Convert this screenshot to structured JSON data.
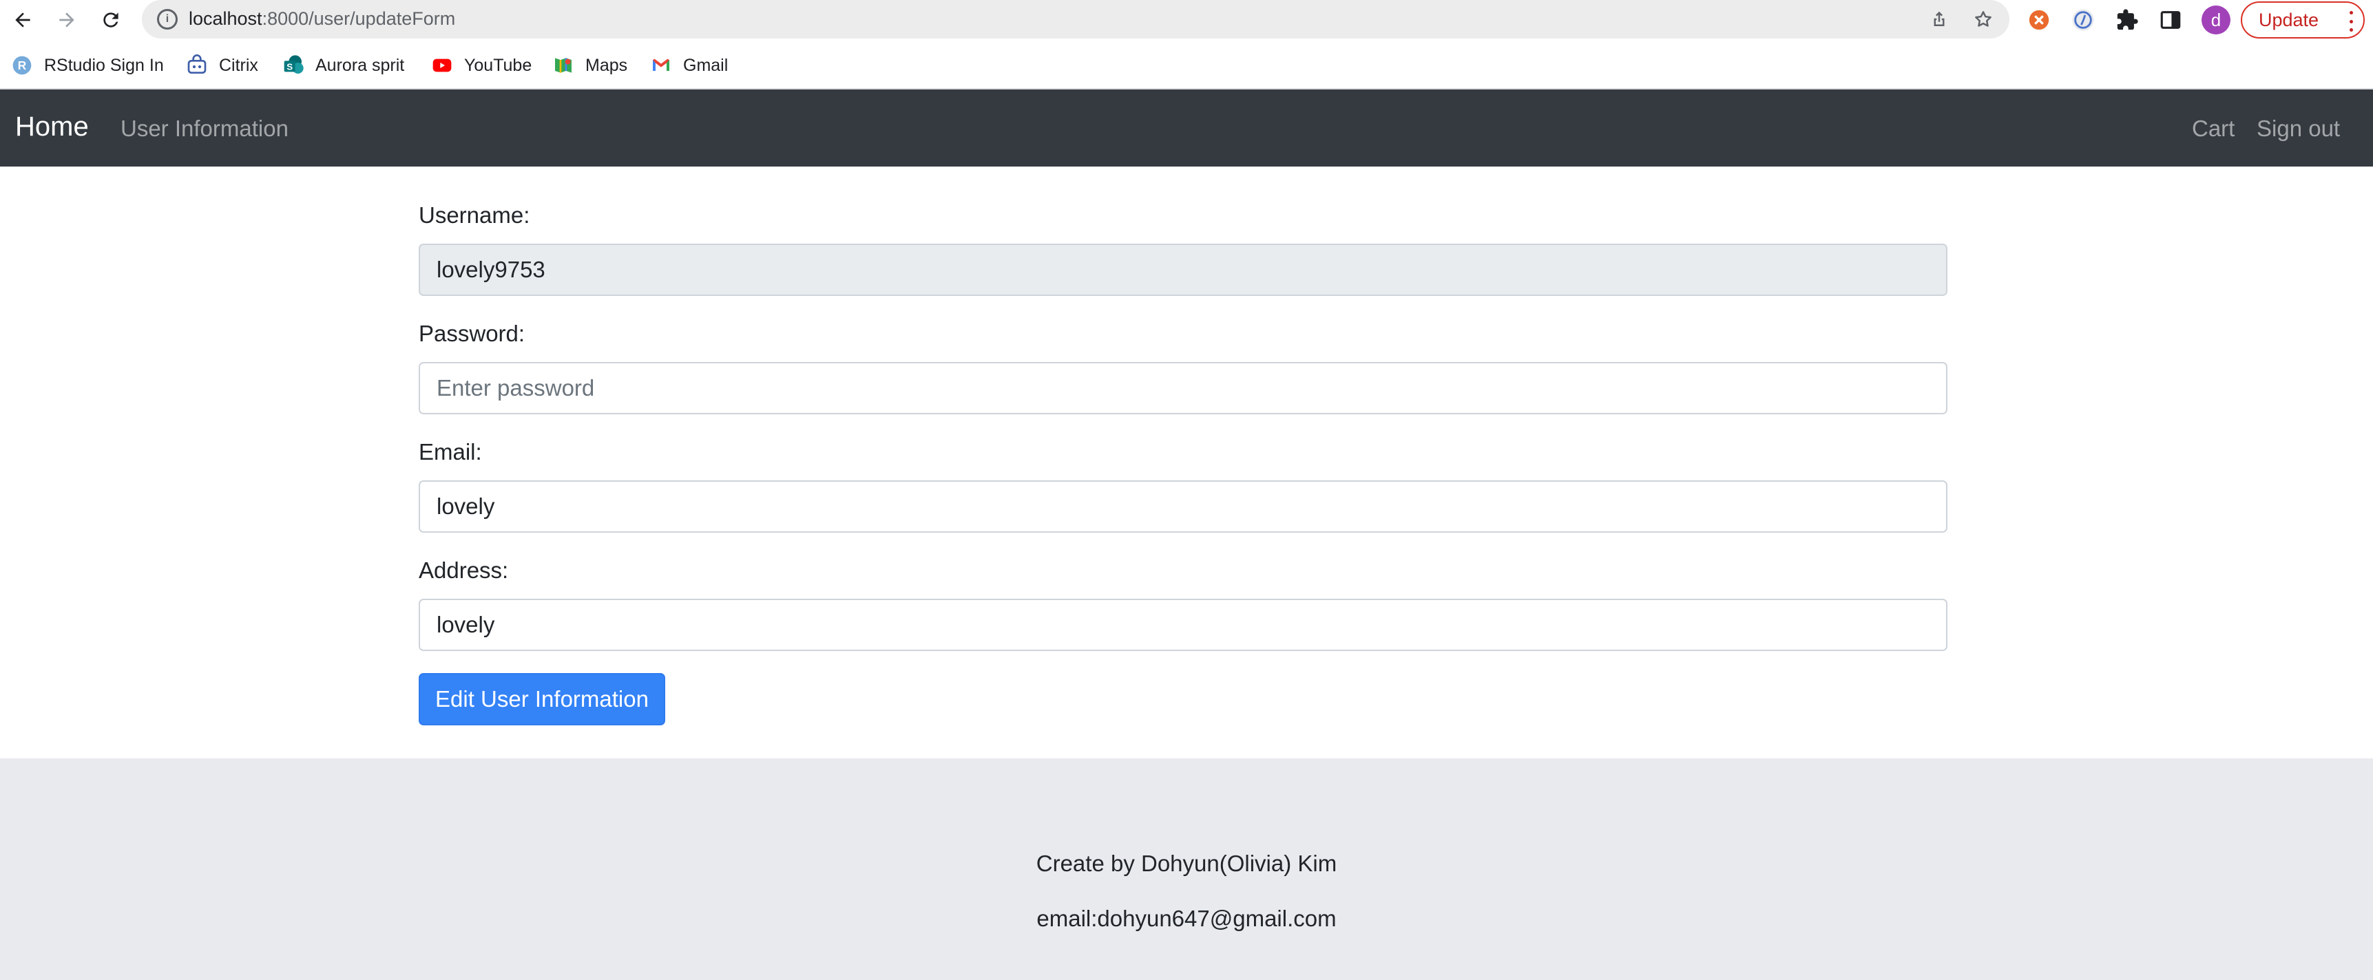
{
  "browser": {
    "url_host": "localhost",
    "url_path": ":8000/user/updateForm",
    "update_label": "Update",
    "profile_initial": "d",
    "bookmarks": [
      {
        "label": "RStudio Sign In",
        "icon": "rstudio-icon"
      },
      {
        "label": "Citrix",
        "icon": "citrix-icon"
      },
      {
        "label": "Aurora sprit",
        "icon": "sharepoint-icon"
      },
      {
        "label": "YouTube",
        "icon": "youtube-icon"
      },
      {
        "label": "Maps",
        "icon": "maps-icon"
      },
      {
        "label": "Gmail",
        "icon": "gmail-icon"
      }
    ]
  },
  "navbar": {
    "brand": "Home",
    "left_links": [
      "User Information"
    ],
    "right_links": [
      "Cart",
      "Sign out"
    ]
  },
  "form": {
    "username_label": "Username:",
    "username_value": "lovely9753",
    "password_label": "Password:",
    "password_placeholder": "Enter password",
    "email_label": "Email:",
    "email_value": "lovely",
    "address_label": "Address:",
    "address_value": "lovely",
    "submit_label": "Edit User Information"
  },
  "footer": {
    "credit": "Create by Dohyun(Olivia) Kim",
    "email": "email:dohyun647@gmail.com"
  },
  "colors": {
    "navbar_bg": "#343a40",
    "primary": "#3483f7",
    "footer_bg": "#e9eaee",
    "update_red": "#c5221f",
    "profile_purple": "#a142b8"
  }
}
